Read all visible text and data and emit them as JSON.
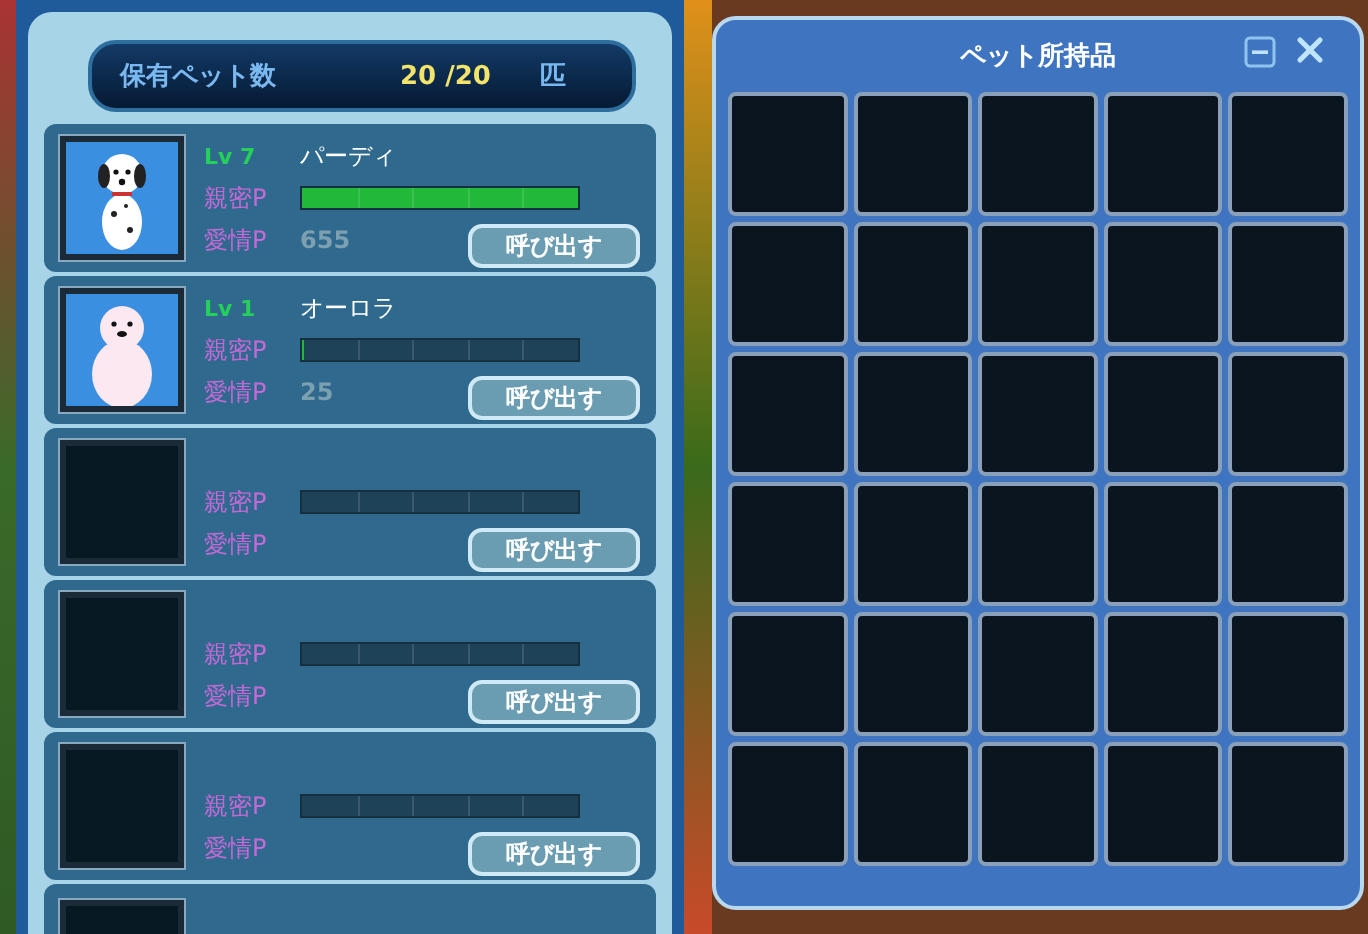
{
  "pet_list": {
    "header": {
      "label": "保有ペット数",
      "count": "20 /20",
      "unit": "匹"
    },
    "slots": [
      {
        "kind": "pet",
        "portrait": {
          "kind": "dog"
        },
        "level": "Lv 7",
        "name": "パーディ",
        "intimacy_label": "親密P",
        "intimacy": {
          "level": 1.0
        },
        "affection_label": "愛情P",
        "affection": "655",
        "button": "呼び出す"
      },
      {
        "kind": "pet",
        "portrait": {
          "kind": "seal"
        },
        "level": "Lv 1",
        "name": "オーロラ",
        "intimacy_label": "親密P",
        "intimacy": {
          "level": 0.01
        },
        "affection_label": "愛情P",
        "affection": "25",
        "button": "呼び出す"
      },
      {
        "kind": "empty",
        "intimacy_label": "親密P",
        "affection_label": "愛情P",
        "button": "呼び出す"
      },
      {
        "kind": "empty",
        "intimacy_label": "親密P",
        "affection_label": "愛情P",
        "button": "呼び出す"
      },
      {
        "kind": "empty",
        "intimacy_label": "親密P",
        "affection_label": "愛情P",
        "button": "呼び出す"
      },
      {
        "kind": "partial"
      }
    ]
  },
  "inventory": {
    "title": "ペット所持品",
    "rows": [
      [
        {
          "filled": false
        },
        {
          "filled": false
        },
        {
          "filled": false
        },
        {
          "filled": false
        },
        {
          "filled": false
        }
      ],
      [
        {
          "filled": false
        },
        {
          "filled": false
        },
        {
          "filled": false
        },
        {
          "filled": false
        },
        {
          "filled": false
        }
      ],
      [
        {
          "filled": false
        },
        {
          "filled": false
        },
        {
          "filled": false
        },
        {
          "filled": false
        },
        {
          "filled": false
        }
      ],
      [
        {
          "filled": false
        },
        {
          "filled": false
        },
        {
          "filled": false
        },
        {
          "filled": false
        },
        {
          "filled": false
        }
      ],
      [
        {
          "filled": false
        },
        {
          "filled": false
        },
        {
          "filled": false
        },
        {
          "filled": false
        },
        {
          "filled": false
        }
      ],
      [
        {
          "filled": false
        },
        {
          "filled": false
        },
        {
          "filled": false
        },
        {
          "filled": false
        },
        {
          "filled": false
        }
      ]
    ]
  }
}
